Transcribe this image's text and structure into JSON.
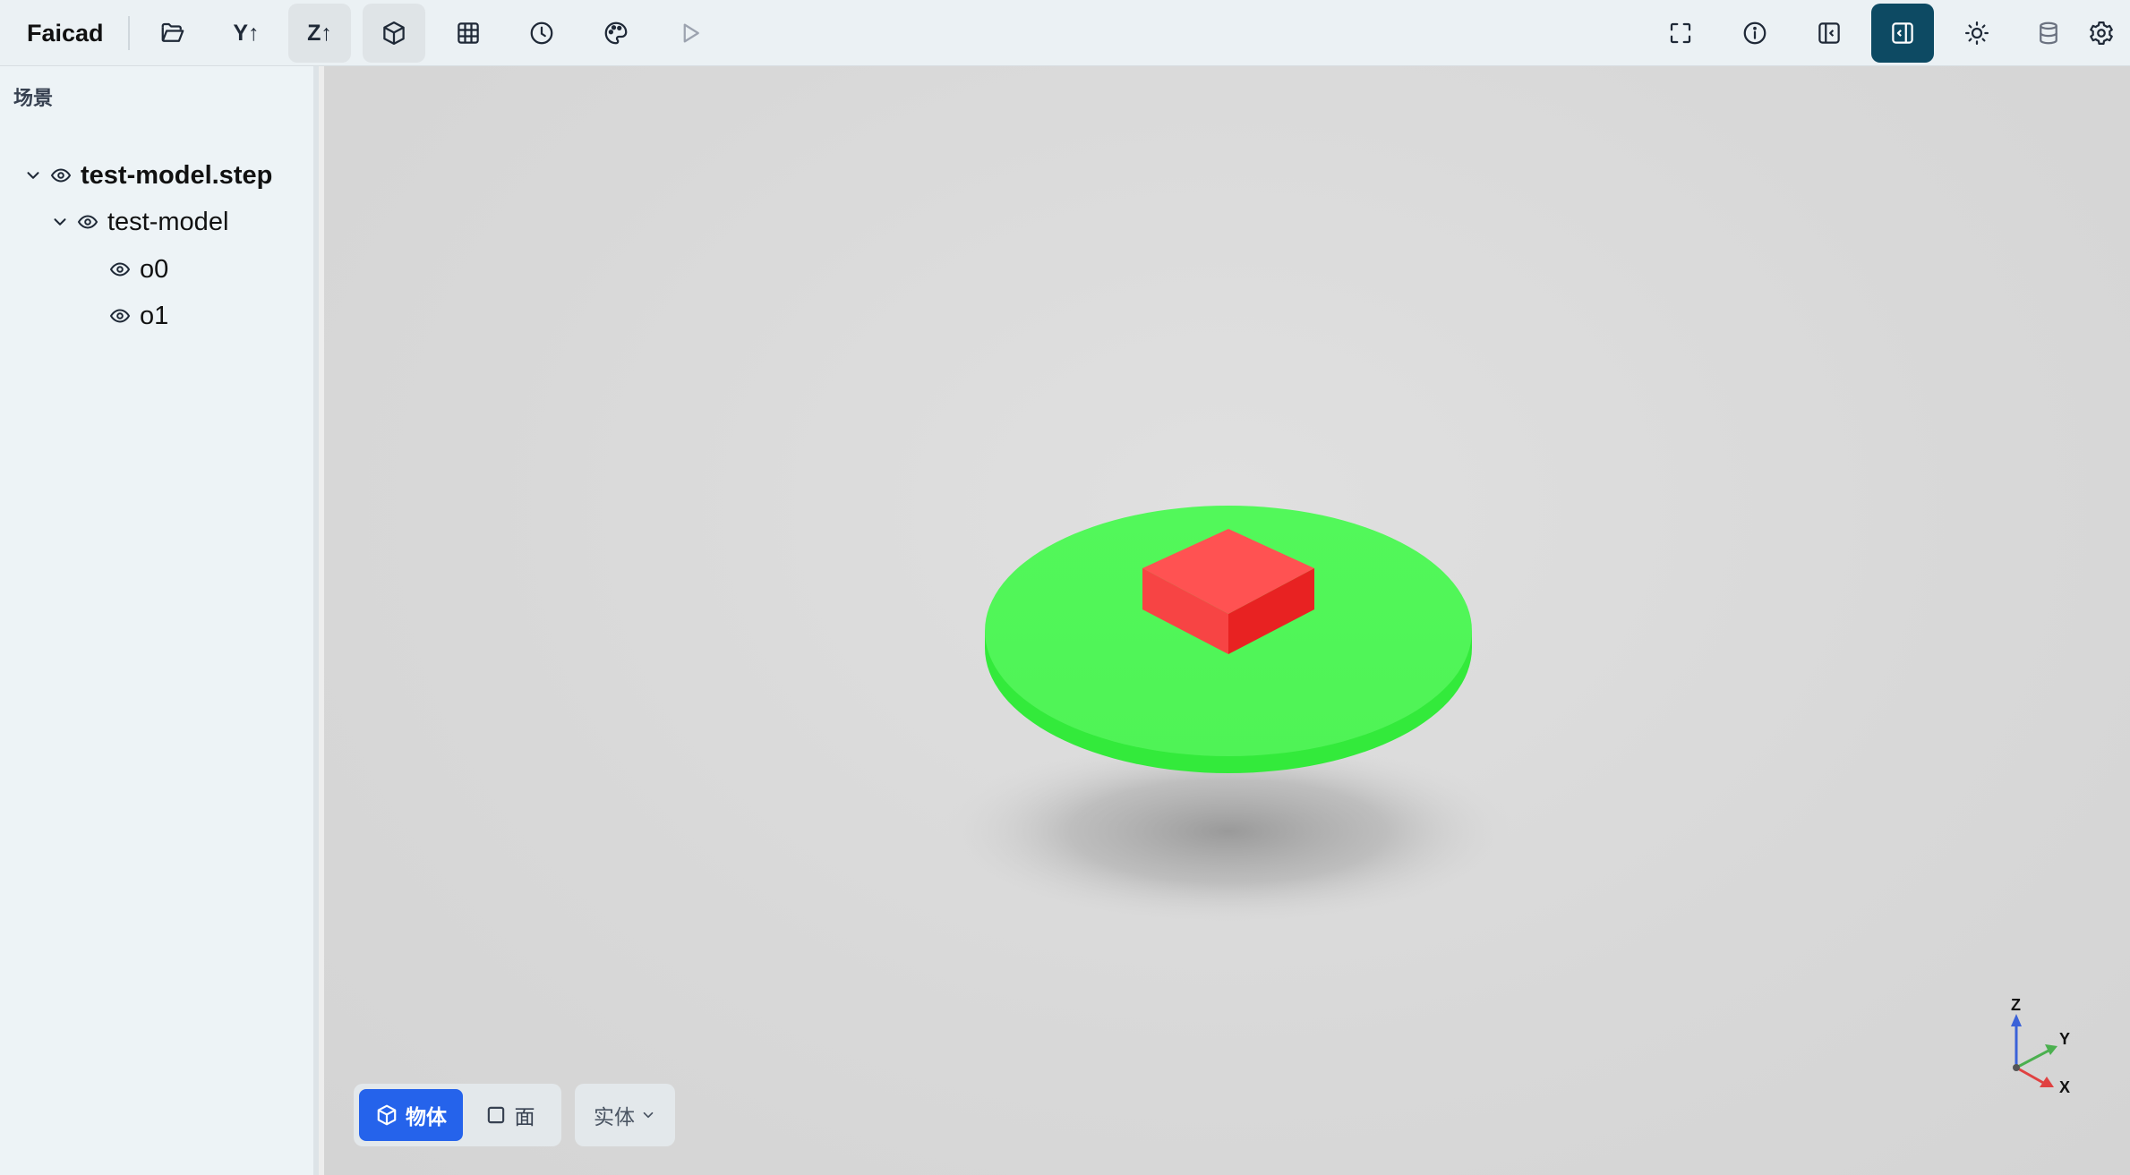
{
  "app": {
    "title": "Faicad"
  },
  "toolbar": {
    "left": [
      {
        "name": "open-folder",
        "icon": "folder-open-icon"
      },
      {
        "name": "y-up",
        "label": "Y↑"
      },
      {
        "name": "z-up",
        "label": "Z↑",
        "active": true
      },
      {
        "name": "view-cube",
        "icon": "cube-icon",
        "active": true
      },
      {
        "name": "grid",
        "icon": "grid-icon"
      },
      {
        "name": "history",
        "icon": "clock-icon"
      },
      {
        "name": "appearance",
        "icon": "palette-icon"
      },
      {
        "name": "run",
        "icon": "play-icon"
      }
    ],
    "right": [
      {
        "name": "fullscreen",
        "icon": "fullscreen-icon"
      },
      {
        "name": "info",
        "icon": "info-icon"
      },
      {
        "name": "left-panel",
        "icon": "panel-left-icon"
      },
      {
        "name": "right-panel",
        "icon": "panel-right-icon",
        "active": true
      },
      {
        "name": "theme",
        "icon": "sun-icon"
      },
      {
        "name": "database",
        "icon": "database-icon"
      },
      {
        "name": "settings",
        "icon": "gear-icon"
      }
    ]
  },
  "sidebar": {
    "title": "场景",
    "tree": [
      {
        "label": "test-model.step",
        "level": 0,
        "expanded": true
      },
      {
        "label": "test-model",
        "level": 1,
        "expanded": true
      },
      {
        "label": "o0",
        "level": 2
      },
      {
        "label": "o1",
        "level": 2
      }
    ]
  },
  "viewport": {
    "selection_modes": [
      {
        "label": "物体",
        "active": true
      },
      {
        "label": "面",
        "active": false
      }
    ],
    "display_mode": {
      "value": "实体"
    },
    "axes": {
      "x": "X",
      "y": "Y",
      "z": "Z"
    },
    "colors": {
      "disk": "#4cf552",
      "box": "#ff4d4d",
      "accent": "#2563eb",
      "primary": "#0d4a63"
    }
  }
}
